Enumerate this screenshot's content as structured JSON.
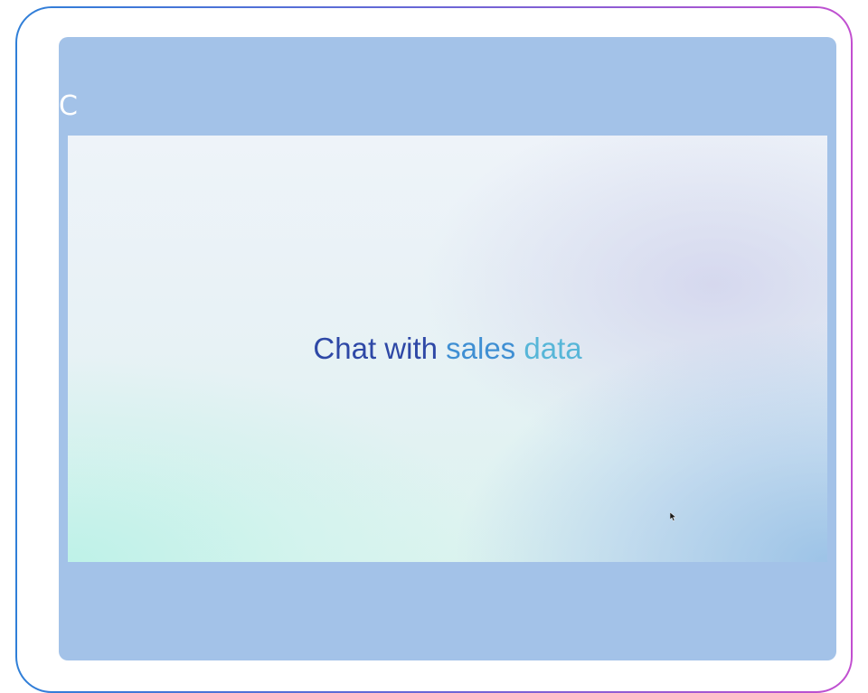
{
  "panel": {
    "corner_letter": "C"
  },
  "slide": {
    "title_part_1": "Chat with",
    "title_part_2": "sales",
    "title_part_3": "data"
  },
  "colors": {
    "frame_gradient_start": "#2f7fd8",
    "frame_gradient_end": "#c24fd0",
    "panel_background": "#a3c2e8",
    "title_dark_blue": "#2e48a6",
    "title_mid_blue": "#3f8fd3",
    "title_light_blue": "#57b6d8"
  },
  "icons": {
    "cursor": "mouse-pointer-icon"
  }
}
